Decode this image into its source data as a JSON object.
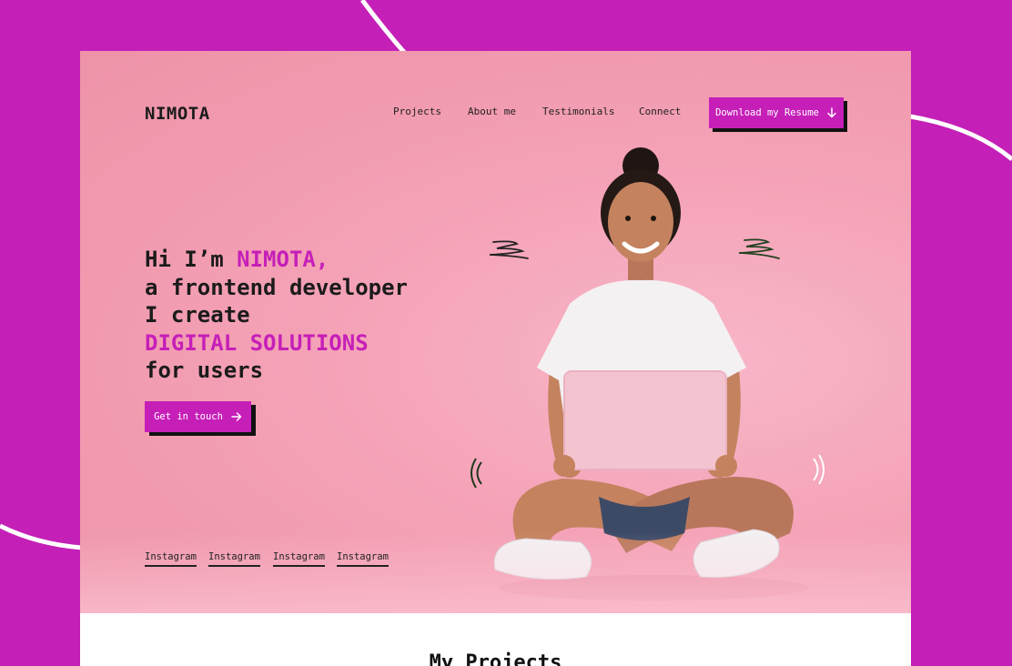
{
  "brand": {
    "logo": "NIMOTA",
    "accent_color": "#c61fb8",
    "page_background": "#c41fb7"
  },
  "nav": {
    "items": [
      "Projects",
      "About me",
      "Testimonials",
      "Connect"
    ],
    "resume_button": "Download my Resume",
    "resume_icon": "arrow-down-icon"
  },
  "hero": {
    "line1_prefix": "Hi I’m ",
    "line1_name": "NIMOTA,",
    "line2": "a frontend developer",
    "line3": "I create",
    "line4": "DIGITAL SOLUTIONS",
    "line5": "for users",
    "cta_label": "Get in touch",
    "cta_icon": "arrow-right-icon",
    "image_subject": "smiling-girl-with-laptop-photo"
  },
  "social": {
    "links": [
      "Instagram",
      "Instagram",
      "Instagram",
      "Instagram"
    ]
  },
  "next_section": {
    "title": "My Projects"
  }
}
